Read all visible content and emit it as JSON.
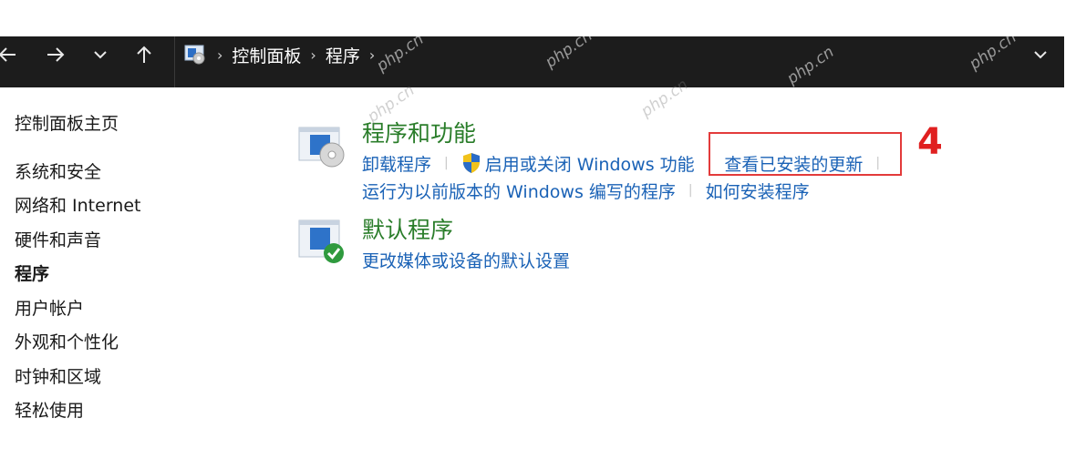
{
  "breadcrumb": {
    "items": [
      "控制面板",
      "程序"
    ],
    "separator": "›"
  },
  "navigation": {
    "back_icon": "arrow-left-icon",
    "forward_icon": "arrow-right-icon",
    "recent_icon": "chevron-down-icon",
    "up_icon": "arrow-up-icon"
  },
  "watermark": "php.cn",
  "sidebar": {
    "home": "控制面板主页",
    "items": [
      {
        "label": "系统和安全",
        "active": false
      },
      {
        "label": "网络和 Internet",
        "active": false
      },
      {
        "label": "硬件和声音",
        "active": false
      },
      {
        "label": "程序",
        "active": true
      },
      {
        "label": "用户帐户",
        "active": false
      },
      {
        "label": "外观和个性化",
        "active": false
      },
      {
        "label": "时钟和区域",
        "active": false
      },
      {
        "label": "轻松使用",
        "active": false
      }
    ]
  },
  "main": {
    "programs_features": {
      "title": "程序和功能",
      "links": {
        "uninstall": "卸载程序",
        "toggle_features": "启用或关闭 Windows 功能",
        "view_updates": "查看已安装的更新",
        "compat": "运行为以前版本的 Windows 编写的程序",
        "how_install": "如何安装程序"
      }
    },
    "default_programs": {
      "title": "默认程序",
      "links": {
        "change_defaults": "更改媒体或设备的默认设置"
      }
    }
  },
  "annotation": {
    "step": "4",
    "color": "#e02020"
  },
  "colors": {
    "navbar": "#1c1c1c",
    "link": "#1a62b6",
    "category_title": "#2a7d2a"
  }
}
